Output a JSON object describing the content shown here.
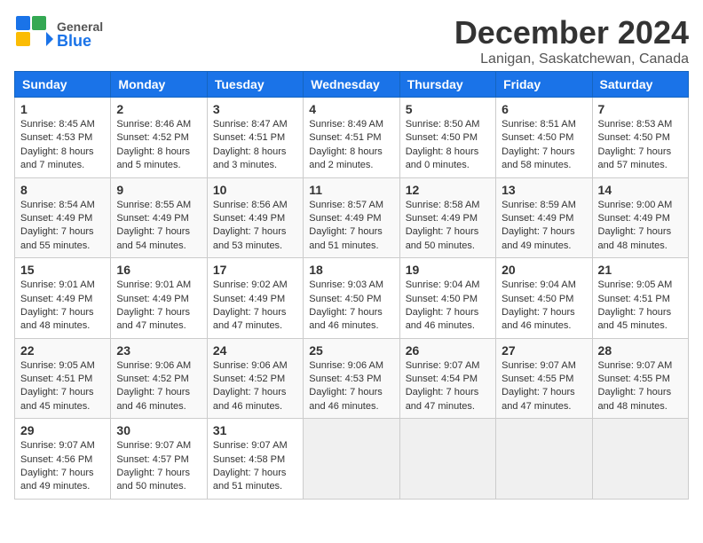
{
  "header": {
    "logo_general": "General",
    "logo_blue": "Blue",
    "month": "December 2024",
    "location": "Lanigan, Saskatchewan, Canada"
  },
  "days_of_week": [
    "Sunday",
    "Monday",
    "Tuesday",
    "Wednesday",
    "Thursday",
    "Friday",
    "Saturday"
  ],
  "weeks": [
    [
      {
        "num": "1",
        "sunrise": "8:45 AM",
        "sunset": "4:53 PM",
        "daylight": "8 hours and 7 minutes."
      },
      {
        "num": "2",
        "sunrise": "8:46 AM",
        "sunset": "4:52 PM",
        "daylight": "8 hours and 5 minutes."
      },
      {
        "num": "3",
        "sunrise": "8:47 AM",
        "sunset": "4:51 PM",
        "daylight": "8 hours and 3 minutes."
      },
      {
        "num": "4",
        "sunrise": "8:49 AM",
        "sunset": "4:51 PM",
        "daylight": "8 hours and 2 minutes."
      },
      {
        "num": "5",
        "sunrise": "8:50 AM",
        "sunset": "4:50 PM",
        "daylight": "8 hours and 0 minutes."
      },
      {
        "num": "6",
        "sunrise": "8:51 AM",
        "sunset": "4:50 PM",
        "daylight": "7 hours and 58 minutes."
      },
      {
        "num": "7",
        "sunrise": "8:53 AM",
        "sunset": "4:50 PM",
        "daylight": "7 hours and 57 minutes."
      }
    ],
    [
      {
        "num": "8",
        "sunrise": "8:54 AM",
        "sunset": "4:49 PM",
        "daylight": "7 hours and 55 minutes."
      },
      {
        "num": "9",
        "sunrise": "8:55 AM",
        "sunset": "4:49 PM",
        "daylight": "7 hours and 54 minutes."
      },
      {
        "num": "10",
        "sunrise": "8:56 AM",
        "sunset": "4:49 PM",
        "daylight": "7 hours and 53 minutes."
      },
      {
        "num": "11",
        "sunrise": "8:57 AM",
        "sunset": "4:49 PM",
        "daylight": "7 hours and 51 minutes."
      },
      {
        "num": "12",
        "sunrise": "8:58 AM",
        "sunset": "4:49 PM",
        "daylight": "7 hours and 50 minutes."
      },
      {
        "num": "13",
        "sunrise": "8:59 AM",
        "sunset": "4:49 PM",
        "daylight": "7 hours and 49 minutes."
      },
      {
        "num": "14",
        "sunrise": "9:00 AM",
        "sunset": "4:49 PM",
        "daylight": "7 hours and 48 minutes."
      }
    ],
    [
      {
        "num": "15",
        "sunrise": "9:01 AM",
        "sunset": "4:49 PM",
        "daylight": "7 hours and 48 minutes."
      },
      {
        "num": "16",
        "sunrise": "9:01 AM",
        "sunset": "4:49 PM",
        "daylight": "7 hours and 47 minutes."
      },
      {
        "num": "17",
        "sunrise": "9:02 AM",
        "sunset": "4:49 PM",
        "daylight": "7 hours and 47 minutes."
      },
      {
        "num": "18",
        "sunrise": "9:03 AM",
        "sunset": "4:50 PM",
        "daylight": "7 hours and 46 minutes."
      },
      {
        "num": "19",
        "sunrise": "9:04 AM",
        "sunset": "4:50 PM",
        "daylight": "7 hours and 46 minutes."
      },
      {
        "num": "20",
        "sunrise": "9:04 AM",
        "sunset": "4:50 PM",
        "daylight": "7 hours and 46 minutes."
      },
      {
        "num": "21",
        "sunrise": "9:05 AM",
        "sunset": "4:51 PM",
        "daylight": "7 hours and 45 minutes."
      }
    ],
    [
      {
        "num": "22",
        "sunrise": "9:05 AM",
        "sunset": "4:51 PM",
        "daylight": "7 hours and 45 minutes."
      },
      {
        "num": "23",
        "sunrise": "9:06 AM",
        "sunset": "4:52 PM",
        "daylight": "7 hours and 46 minutes."
      },
      {
        "num": "24",
        "sunrise": "9:06 AM",
        "sunset": "4:52 PM",
        "daylight": "7 hours and 46 minutes."
      },
      {
        "num": "25",
        "sunrise": "9:06 AM",
        "sunset": "4:53 PM",
        "daylight": "7 hours and 46 minutes."
      },
      {
        "num": "26",
        "sunrise": "9:07 AM",
        "sunset": "4:54 PM",
        "daylight": "7 hours and 47 minutes."
      },
      {
        "num": "27",
        "sunrise": "9:07 AM",
        "sunset": "4:55 PM",
        "daylight": "7 hours and 47 minutes."
      },
      {
        "num": "28",
        "sunrise": "9:07 AM",
        "sunset": "4:55 PM",
        "daylight": "7 hours and 48 minutes."
      }
    ],
    [
      {
        "num": "29",
        "sunrise": "9:07 AM",
        "sunset": "4:56 PM",
        "daylight": "7 hours and 49 minutes."
      },
      {
        "num": "30",
        "sunrise": "9:07 AM",
        "sunset": "4:57 PM",
        "daylight": "7 hours and 50 minutes."
      },
      {
        "num": "31",
        "sunrise": "9:07 AM",
        "sunset": "4:58 PM",
        "daylight": "7 hours and 51 minutes."
      },
      null,
      null,
      null,
      null
    ]
  ],
  "labels": {
    "sunrise": "Sunrise:",
    "sunset": "Sunset:",
    "daylight": "Daylight:"
  }
}
